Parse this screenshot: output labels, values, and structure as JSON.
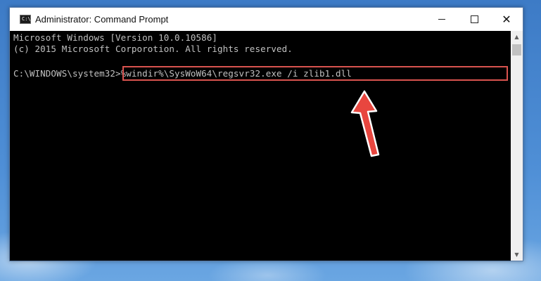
{
  "window": {
    "title": "Administrator: Command Prompt",
    "controls": {
      "minimize": "minimize",
      "maximize": "maximize",
      "close": "✕"
    }
  },
  "console": {
    "lines": [
      "Microsoft Windows [Version 10.0.10586]",
      "(c) 2015 Microsoft Corporotion. All rights reserved."
    ],
    "prompt": "C:\\WINDOWS\\system32>",
    "command": "%windir%\\SysWoW64\\regsvr32.exe /i zlib1.dll"
  },
  "annotation": {
    "highlight_color": "#d9534f",
    "arrow_color": "#e8463f"
  },
  "scrollbar": {
    "up": "▲",
    "down": "▼"
  }
}
